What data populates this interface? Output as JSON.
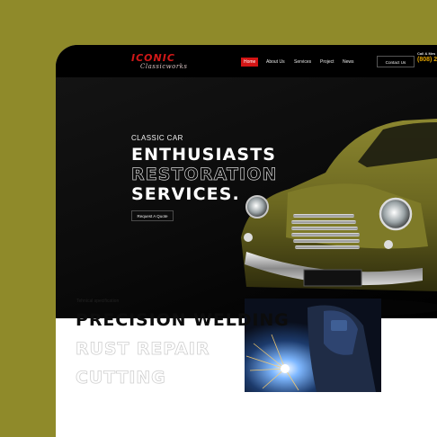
{
  "brand": {
    "logo_top": "ICONIC",
    "logo_sub": "Classicworks"
  },
  "nav": {
    "items": [
      {
        "label": "Home",
        "active": true
      },
      {
        "label": "About Us",
        "active": false
      },
      {
        "label": "Services",
        "active": false
      },
      {
        "label": "Project",
        "active": false
      },
      {
        "label": "News",
        "active": false
      }
    ],
    "contact_button": "Contact Us",
    "call_label": "Call & Mes",
    "call_number": "(808) 2"
  },
  "hero": {
    "subtitle": "CLASSIC CAR",
    "line1": "ENTHUSIASTS",
    "line2": "RESTORATION",
    "line3": "SERVICES.",
    "cta": "Request A Quote"
  },
  "specs": {
    "label": "Tehnical specification",
    "line1": "PRECISION WELDING",
    "line2": "RUST REPAIR",
    "line3": "CUTTING"
  },
  "colors": {
    "accent": "#d31515",
    "phone": "#e2a400",
    "background": "#8f8a2a",
    "car": "#6f6b1f"
  }
}
